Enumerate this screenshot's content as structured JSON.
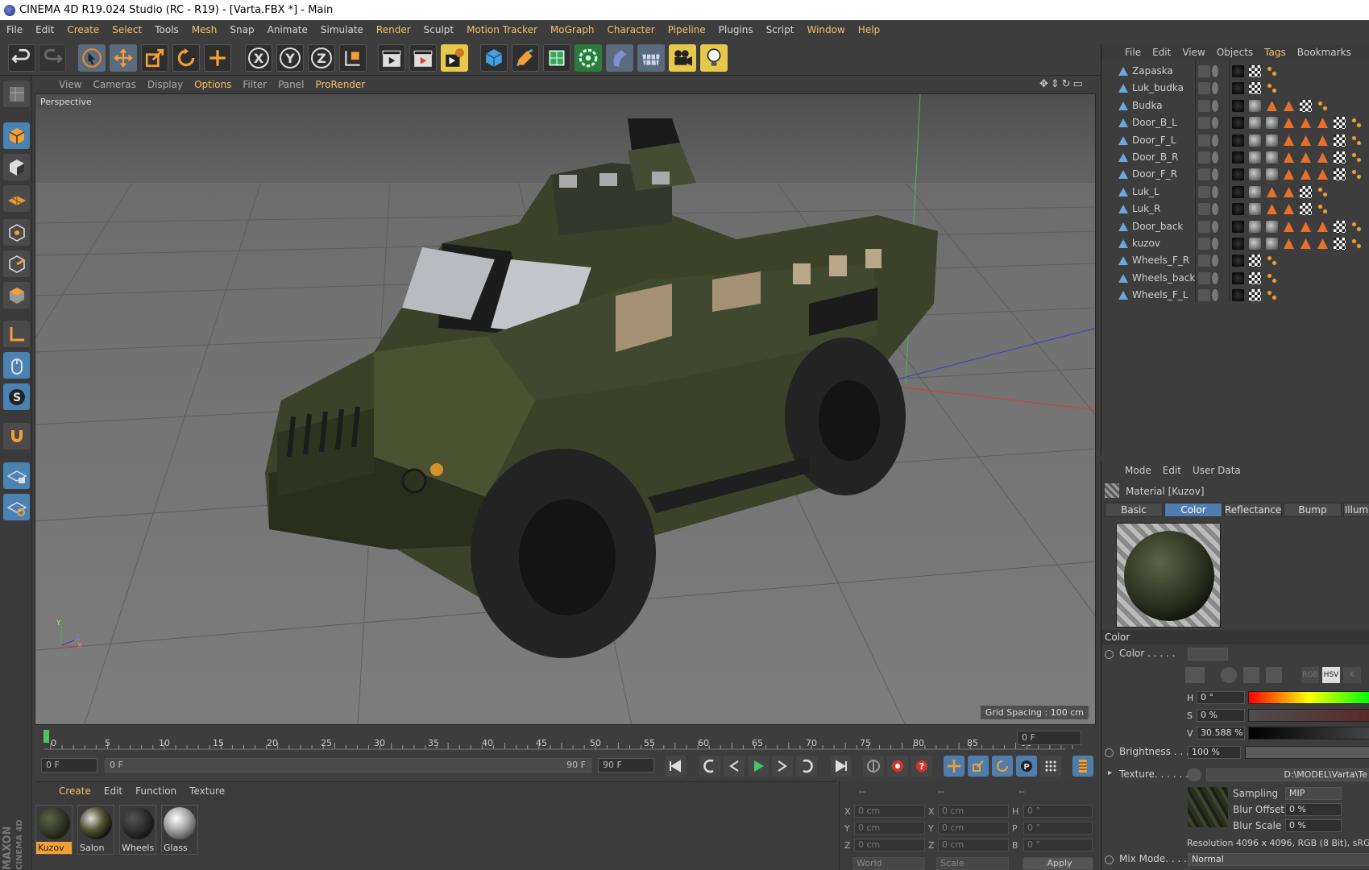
{
  "window": {
    "title": "CINEMA 4D R19.024 Studio (RC - R19) - [Varta.FBX *] - Main"
  },
  "menubar": [
    "File",
    "Edit",
    "Create",
    "Select",
    "Tools",
    "Mesh",
    "Snap",
    "Animate",
    "Simulate",
    "Render",
    "Sculpt",
    "Motion Tracker",
    "MoGraph",
    "Character",
    "Pipeline",
    "Plugins",
    "Script",
    "Window",
    "Help"
  ],
  "toolbar": {
    "axis_x": "X",
    "axis_y": "Y",
    "axis_z": "Z"
  },
  "viewport": {
    "menu": [
      "View",
      "Cameras",
      "Display",
      "Options",
      "Filter",
      "Panel",
      "ProRender"
    ],
    "label": "Perspective",
    "grid_spacing": "Grid Spacing : 100 cm",
    "axis_y": "Y",
    "axis_z": "Z",
    "axis_x": "X"
  },
  "timeline": {
    "ticks": [
      "0",
      "5",
      "10",
      "15",
      "20",
      "25",
      "30",
      "35",
      "40",
      "45",
      "50",
      "55",
      "60",
      "65",
      "70",
      "75",
      "80",
      "85",
      "90"
    ],
    "current_frame": "0 F",
    "start_frame": "0 F",
    "range_start": "0 F",
    "range_end": "90 F",
    "end_frame": "90 F"
  },
  "material_manager": {
    "menu": [
      "Create",
      "Edit",
      "Function",
      "Texture"
    ],
    "materials": [
      {
        "name": "Kuzov",
        "selected": true
      },
      {
        "name": "Salon",
        "selected": false
      },
      {
        "name": "Wheels",
        "selected": false
      },
      {
        "name": "Glass",
        "selected": false
      }
    ]
  },
  "coordinates": {
    "headers": [
      "--",
      "--",
      "--"
    ],
    "rows": [
      {
        "l1": "X",
        "v1": "0 cm",
        "l2": "X",
        "v2": "0 cm",
        "l3": "H",
        "v3": "0 °"
      },
      {
        "l1": "Y",
        "v1": "0 cm",
        "l2": "Y",
        "v2": "0 cm",
        "l3": "P",
        "v3": "0 °"
      },
      {
        "l1": "Z",
        "v1": "0 cm",
        "l2": "Z",
        "v2": "0 cm",
        "l3": "B",
        "v3": "0 °"
      }
    ],
    "mode1": "World",
    "mode2": "Scale",
    "apply": "Apply"
  },
  "object_manager": {
    "menu": [
      "File",
      "Edit",
      "View",
      "Objects",
      "Tags",
      "Bookmarks"
    ],
    "objects": [
      "Zapaska",
      "Luk_budka",
      "Budka",
      "Door_B_L",
      "Door_F_L",
      "Door_B_R",
      "Door_F_R",
      "Luk_L",
      "Luk_R",
      "Door_back",
      "kuzov",
      "Wheels_F_R",
      "Wheels_back",
      "Wheels_F_L"
    ]
  },
  "attributes": {
    "menu": [
      "Mode",
      "Edit",
      "User Data"
    ],
    "material_title": "Material [Kuzov]",
    "tabs": [
      "Basic",
      "Color",
      "Reflectance",
      "Bump",
      "Illum"
    ],
    "active_tab": "Color",
    "section": "Color",
    "color_label": "Color . . . . .",
    "h_label": "H",
    "h_value": "0 °",
    "s_label": "S",
    "s_value": "0 %",
    "v_label": "V",
    "v_value": "30.588 %",
    "brightness_label": "Brightness . . .",
    "brightness_value": "100 %",
    "texture_label": "Texture. . . . . .",
    "texture_path": "D:\\MODEL\\Varta\\Te",
    "sampling_label": "Sampling",
    "sampling_value": "MIP",
    "blur_offset_label": "Blur Offset",
    "blur_offset_value": "0 %",
    "blur_scale_label": "Blur Scale",
    "blur_scale_value": "0 %",
    "resolution": "Resolution 4096 x 4096, RGB (8 Bit), sRGB",
    "mix_mode_label": "Mix Mode. . . .",
    "mix_mode_value": "Normal",
    "rgb_btn": "RGB",
    "hsv_btn": "HSV",
    "k_btn": "K"
  },
  "brand": {
    "vendor": "MAXON",
    "product": "CINEMA 4D"
  }
}
